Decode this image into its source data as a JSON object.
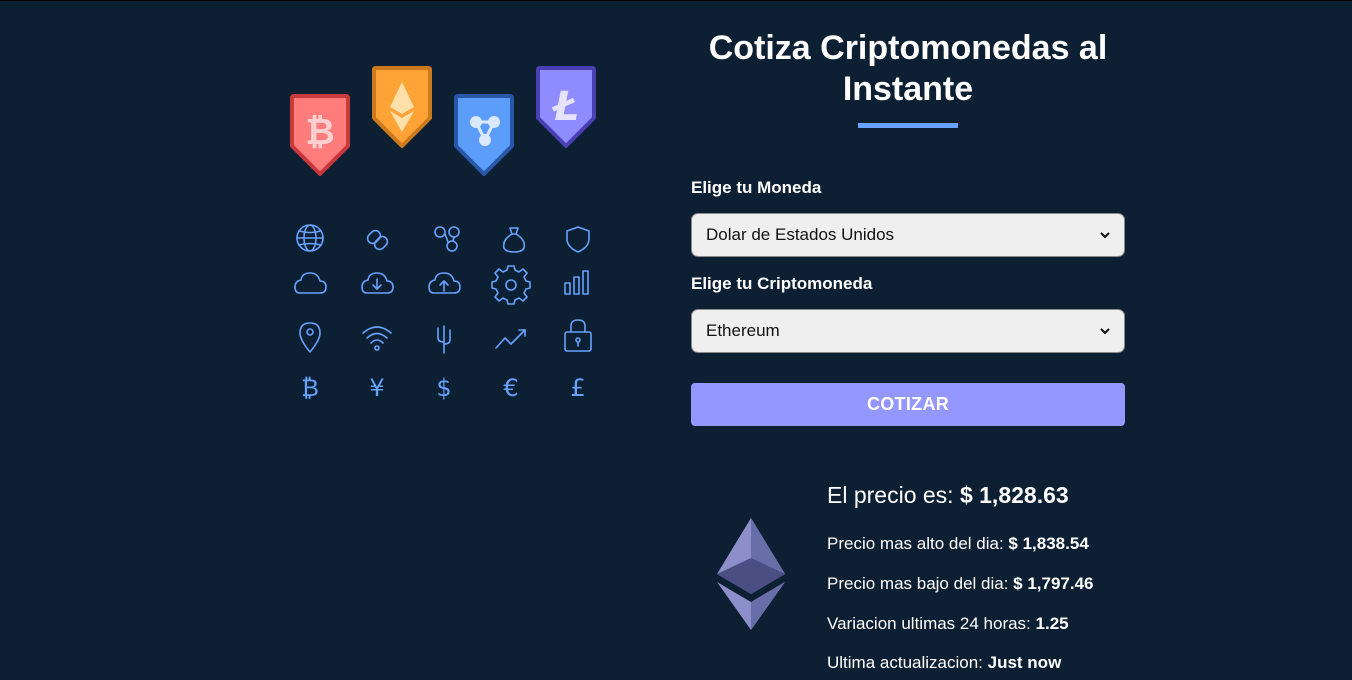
{
  "header": {
    "title": "Cotiza Criptomonedas al Instante"
  },
  "form": {
    "currency_label": "Elige tu Moneda",
    "currency_selected": "Dolar de Estados Unidos",
    "crypto_label": "Elige tu Criptomoneda",
    "crypto_selected": "Ethereum",
    "submit_label": "Cotizar"
  },
  "result": {
    "price_label": "El precio es: ",
    "price_value": "$ 1,828.63",
    "high_label": "Precio mas alto del dia: ",
    "high_value": "$ 1,838.54",
    "low_label": "Precio mas bajo del dia: ",
    "low_value": "$ 1,797.46",
    "change_label": "Variacion ultimas 24 horas: ",
    "change_value": "1.25",
    "updated_label": "Ultima actualizacion: ",
    "updated_value": "Just now"
  },
  "illustration": {
    "badges": [
      "bitcoin-icon",
      "ethereum-icon",
      "ripple-icon",
      "litecoin-icon"
    ],
    "icons": [
      "globe-icon",
      "link-icon",
      "nodes-icon",
      "money-bag-icon",
      "shield-icon",
      "cloud-icon",
      "cloud-download-icon",
      "cloud-upload-icon",
      "gear-icon",
      "bar-chart-icon",
      "location-pin-icon",
      "wifi-icon",
      "usb-icon",
      "trend-up-icon",
      "lock-icon",
      "bitcoin-sign-icon",
      "yen-sign-icon",
      "dollar-sign-icon",
      "euro-sign-icon",
      "pound-sign-icon"
    ]
  },
  "colors": {
    "background": "#0d1f33",
    "accent": "#66a2fe",
    "button": "#9497ff",
    "icon_stroke": "#66a2fe"
  }
}
